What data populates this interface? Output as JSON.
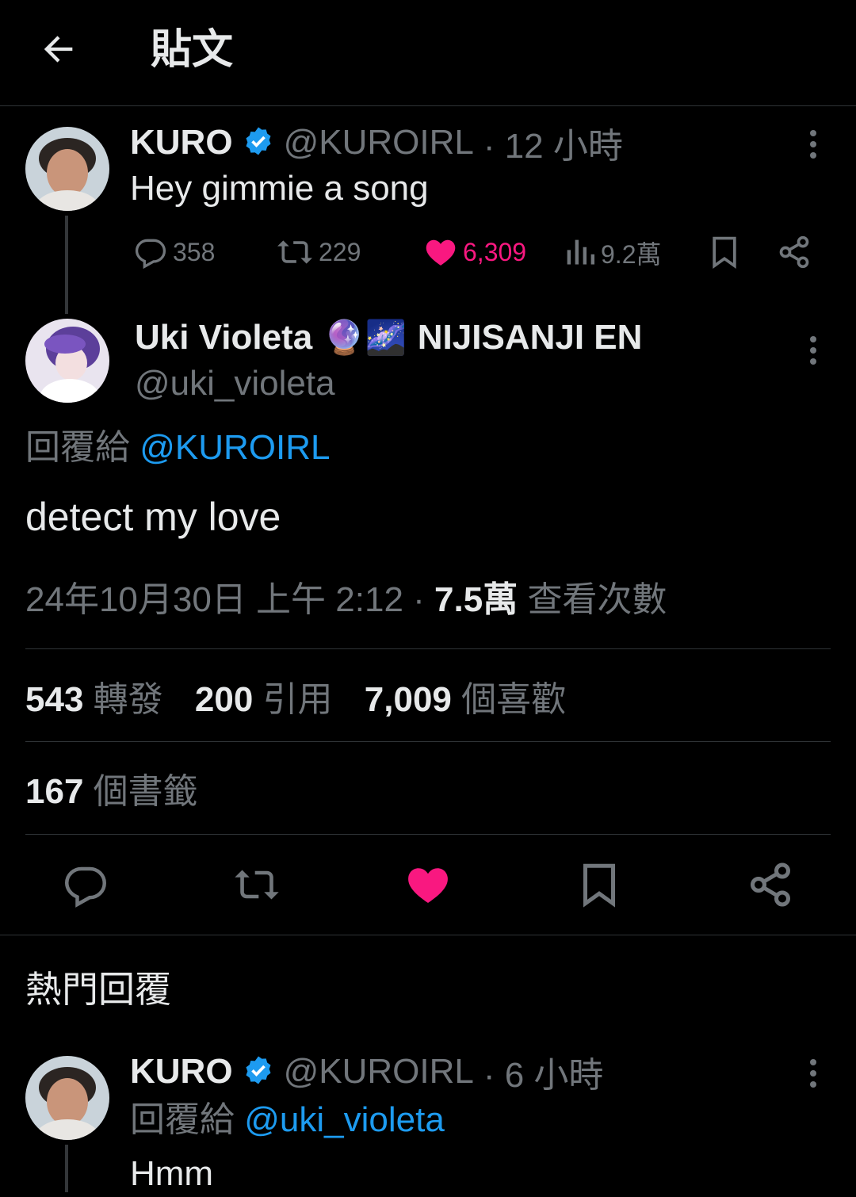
{
  "header": {
    "title": "貼文"
  },
  "parent_tweet": {
    "name": "KURO",
    "handle": "@KUROIRL",
    "time": "· 12 小時",
    "text": "Hey gimmie a song",
    "replies": "358",
    "retweets": "229",
    "likes": "6,309",
    "views": "9.2萬"
  },
  "main_tweet": {
    "name": "Uki Violeta",
    "emoji": "🔮🌌",
    "name_suffix": "NIJISANJI EN",
    "handle": "@uki_violeta",
    "reply_prefix": "回覆給",
    "reply_to": "@KUROIRL",
    "text": "detect my love",
    "timestamp": "24年10月30日 上午 2:12 ·",
    "views_count": "7.5萬",
    "views_label": "查看次數",
    "retweets_count": "543",
    "retweets_label": "轉發",
    "quotes_count": "200",
    "quotes_label": "引用",
    "likes_count": "7,009",
    "likes_label": "個喜歡",
    "bookmarks_count": "167",
    "bookmarks_label": "個書籤"
  },
  "top_replies": {
    "heading": "熱門回覆",
    "first": {
      "name": "KURO",
      "handle": "@KUROIRL",
      "time": "· 6 小時",
      "reply_prefix": "回覆給",
      "reply_to": "@uki_violeta",
      "text": "Hmm"
    }
  },
  "colors": {
    "accent": "#1d9bf0",
    "like": "#f91880",
    "muted": "#71767b",
    "verified": "#1d9bf0"
  }
}
